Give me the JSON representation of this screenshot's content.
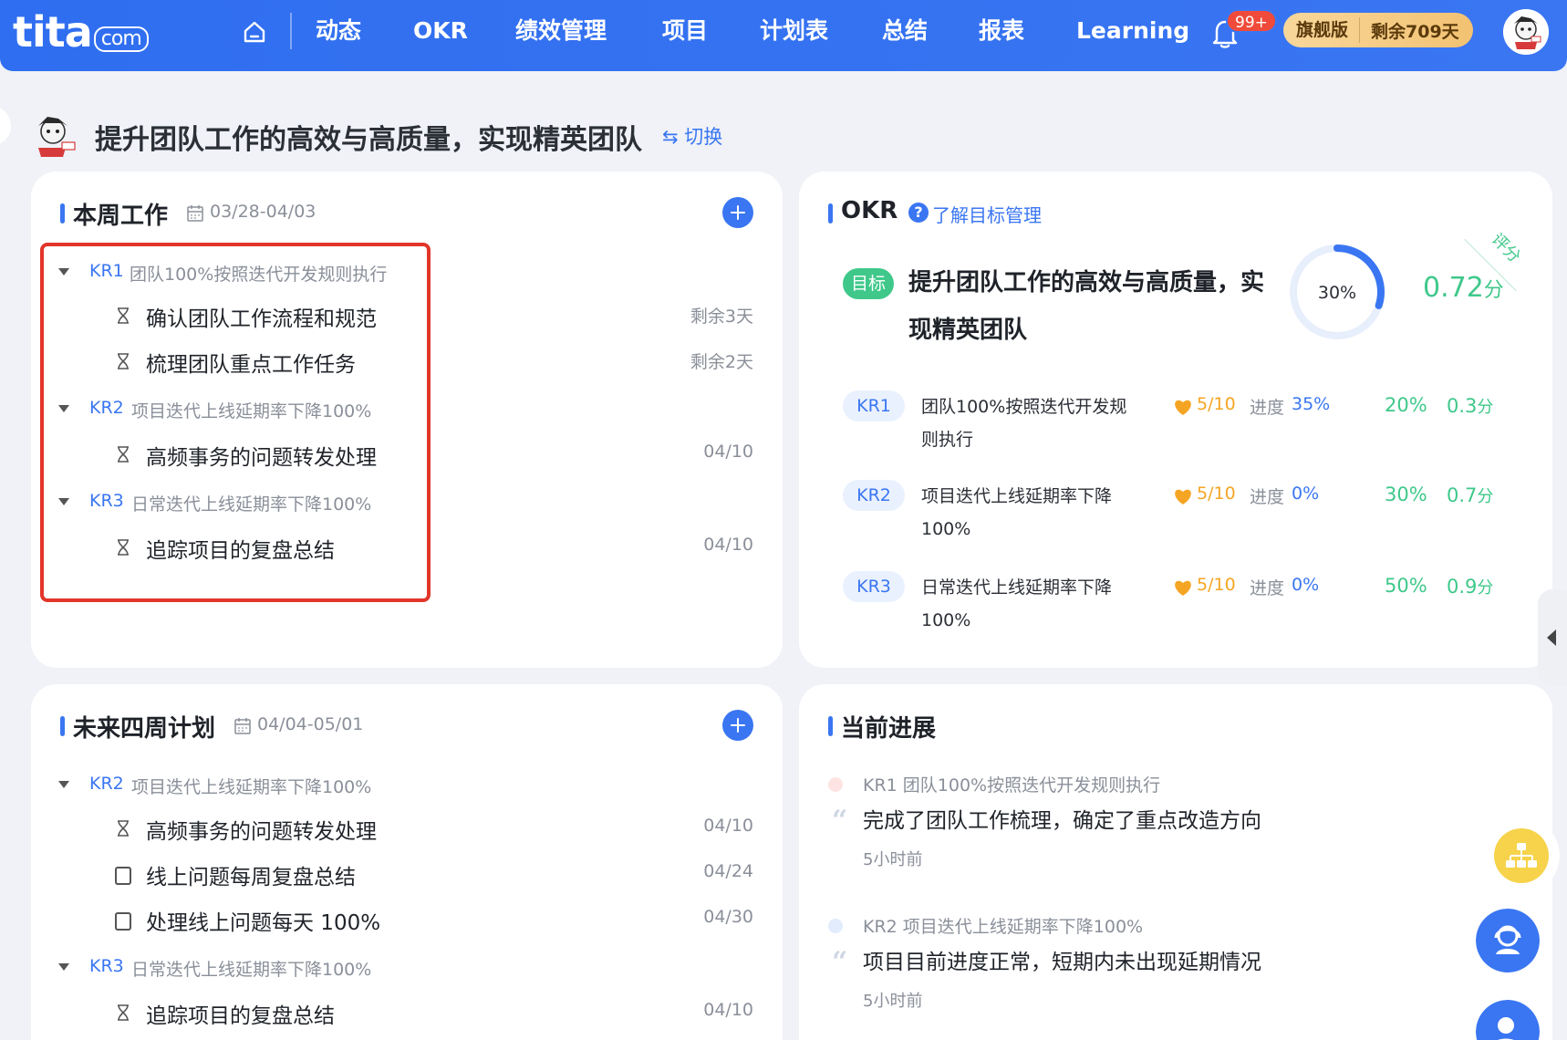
{
  "nav": {
    "logo": "tita",
    "logo_suffix": "com",
    "items": [
      "动态",
      "OKR",
      "绩效管理",
      "项目",
      "计划表",
      "总结",
      "报表",
      "Learning"
    ],
    "notification_badge": "99+",
    "edition": "旗舰版",
    "remaining": "剩余709天"
  },
  "header": {
    "title": "提升团队工作的高效与高质量，实现精英团队",
    "switch_label": "⇆ 切换"
  },
  "this_week": {
    "title": "本周工作",
    "date_range": "03/28-04/03",
    "groups": [
      {
        "code": "KR1",
        "name": "团队100%按照迭代开发规则执行",
        "tasks": [
          {
            "name": "确认团队工作流程和规范",
            "due": "剩余3天",
            "icon": "hourglass-icon"
          },
          {
            "name": "梳理团队重点工作任务",
            "due": "剩余2天",
            "icon": "hourglass-icon"
          }
        ]
      },
      {
        "code": "KR2",
        "name": "项目迭代上线延期率下降100%",
        "tasks": [
          {
            "name": "高频事务的问题转发处理",
            "due": "04/10",
            "icon": "hourglass-icon"
          }
        ]
      },
      {
        "code": "KR3",
        "name": "日常迭代上线延期率下降100%",
        "tasks": [
          {
            "name": "追踪项目的复盘总结",
            "due": "04/10",
            "icon": "hourglass-icon"
          }
        ]
      }
    ]
  },
  "next_four_weeks": {
    "title": "未来四周计划",
    "date_range": "04/04-05/01",
    "groups": [
      {
        "code": "KR2",
        "name": "项目迭代上线延期率下降100%",
        "tasks": [
          {
            "name": "高频事务的问题转发处理",
            "due": "04/10",
            "icon": "hourglass-icon"
          },
          {
            "name": "线上问题每周复盘总结",
            "due": "04/24",
            "icon": "checkbox-icon"
          },
          {
            "name": "处理线上问题每天 100%",
            "due": "04/30",
            "icon": "checkbox-icon"
          }
        ]
      },
      {
        "code": "KR3",
        "name": "日常迭代上线延期率下降100%",
        "tasks": [
          {
            "name": "追踪项目的复盘总结",
            "due": "04/10",
            "icon": "hourglass-icon"
          }
        ]
      }
    ]
  },
  "okr": {
    "title": "OKR",
    "help_label": "了解目标管理",
    "goal_badge": "目标",
    "goal_text": "提升团队工作的高效与高质量，实现精英团队",
    "progress_label": "30%",
    "progress_fraction": 0.3,
    "score": "0.72",
    "score_unit": "分",
    "score_ribbon": "评分",
    "krs": [
      {
        "code": "KR1",
        "desc": "团队100%按照迭代开发规则执行",
        "confidence": "5/10",
        "progress_label": "进度",
        "progress": "35%",
        "weight": "20%",
        "score": "0.3",
        "unit": "分"
      },
      {
        "code": "KR2",
        "desc": "项目迭代上线延期率下降100%",
        "confidence": "5/10",
        "progress_label": "进度",
        "progress": "0%",
        "weight": "30%",
        "score": "0.7",
        "unit": "分"
      },
      {
        "code": "KR3",
        "desc": "日常迭代上线延期率下降100%",
        "confidence": "5/10",
        "progress_label": "进度",
        "progress": "0%",
        "weight": "50%",
        "score": "0.9",
        "unit": "分"
      }
    ]
  },
  "current_progress": {
    "title": "当前进展",
    "items": [
      {
        "kr": "KR1 团队100%按照迭代开发规则执行",
        "text": "完成了团队工作梳理，确定了重点改造方向",
        "time": "5小时前",
        "dot_color": "#e2362a"
      },
      {
        "kr": "KR2 项目迭代上线延期率下降100%",
        "text": "项目目前进度正常，短期内未出现延期情况",
        "time": "5小时前",
        "dot_color": "#3a76f2"
      }
    ]
  },
  "colors": {
    "brand": "#3a76f2",
    "green": "#3fc88a",
    "orange": "#f5a524",
    "highlight": "#e2362a"
  }
}
